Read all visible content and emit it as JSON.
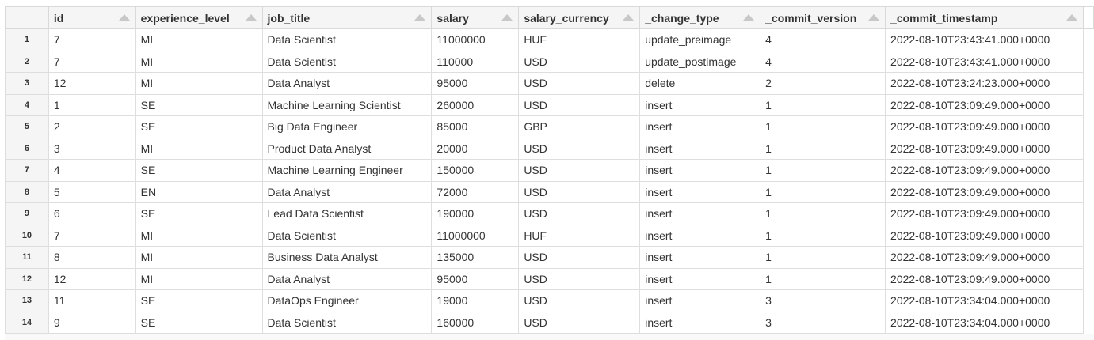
{
  "table": {
    "columns": [
      "id",
      "experience_level",
      "job_title",
      "salary",
      "salary_currency",
      "_change_type",
      "_commit_version",
      "_commit_timestamp"
    ],
    "rows": [
      {
        "n": "1",
        "cells": [
          "7",
          "MI",
          "Data Scientist",
          "11000000",
          "HUF",
          "update_preimage",
          "4",
          "2022-08-10T23:43:41.000+0000"
        ]
      },
      {
        "n": "2",
        "cells": [
          "7",
          "MI",
          "Data Scientist",
          "110000",
          "USD",
          "update_postimage",
          "4",
          "2022-08-10T23:43:41.000+0000"
        ]
      },
      {
        "n": "3",
        "cells": [
          "12",
          "MI",
          "Data Analyst",
          "95000",
          "USD",
          "delete",
          "2",
          "2022-08-10T23:24:23.000+0000"
        ]
      },
      {
        "n": "4",
        "cells": [
          "1",
          "SE",
          "Machine Learning Scientist",
          "260000",
          "USD",
          "insert",
          "1",
          "2022-08-10T23:09:49.000+0000"
        ]
      },
      {
        "n": "5",
        "cells": [
          "2",
          "SE",
          "Big Data Engineer",
          "85000",
          "GBP",
          "insert",
          "1",
          "2022-08-10T23:09:49.000+0000"
        ]
      },
      {
        "n": "6",
        "cells": [
          "3",
          "MI",
          "Product Data Analyst",
          "20000",
          "USD",
          "insert",
          "1",
          "2022-08-10T23:09:49.000+0000"
        ]
      },
      {
        "n": "7",
        "cells": [
          "4",
          "SE",
          "Machine Learning Engineer",
          "150000",
          "USD",
          "insert",
          "1",
          "2022-08-10T23:09:49.000+0000"
        ]
      },
      {
        "n": "8",
        "cells": [
          "5",
          "EN",
          "Data Analyst",
          "72000",
          "USD",
          "insert",
          "1",
          "2022-08-10T23:09:49.000+0000"
        ]
      },
      {
        "n": "9",
        "cells": [
          "6",
          "SE",
          "Lead Data Scientist",
          "190000",
          "USD",
          "insert",
          "1",
          "2022-08-10T23:09:49.000+0000"
        ]
      },
      {
        "n": "10",
        "cells": [
          "7",
          "MI",
          "Data Scientist",
          "11000000",
          "HUF",
          "insert",
          "1",
          "2022-08-10T23:09:49.000+0000"
        ]
      },
      {
        "n": "11",
        "cells": [
          "8",
          "MI",
          "Business Data Analyst",
          "135000",
          "USD",
          "insert",
          "1",
          "2022-08-10T23:09:49.000+0000"
        ]
      },
      {
        "n": "12",
        "cells": [
          "12",
          "MI",
          "Data Analyst",
          "95000",
          "USD",
          "insert",
          "1",
          "2022-08-10T23:09:49.000+0000"
        ]
      },
      {
        "n": "13",
        "cells": [
          "11",
          "SE",
          "DataOps Engineer",
          "19000",
          "USD",
          "insert",
          "3",
          "2022-08-10T23:34:04.000+0000"
        ]
      },
      {
        "n": "14",
        "cells": [
          "9",
          "SE",
          "Data Scientist",
          "160000",
          "USD",
          "insert",
          "3",
          "2022-08-10T23:34:04.000+0000"
        ]
      }
    ]
  },
  "icons": {
    "sort": "sort-ascending-icon"
  }
}
